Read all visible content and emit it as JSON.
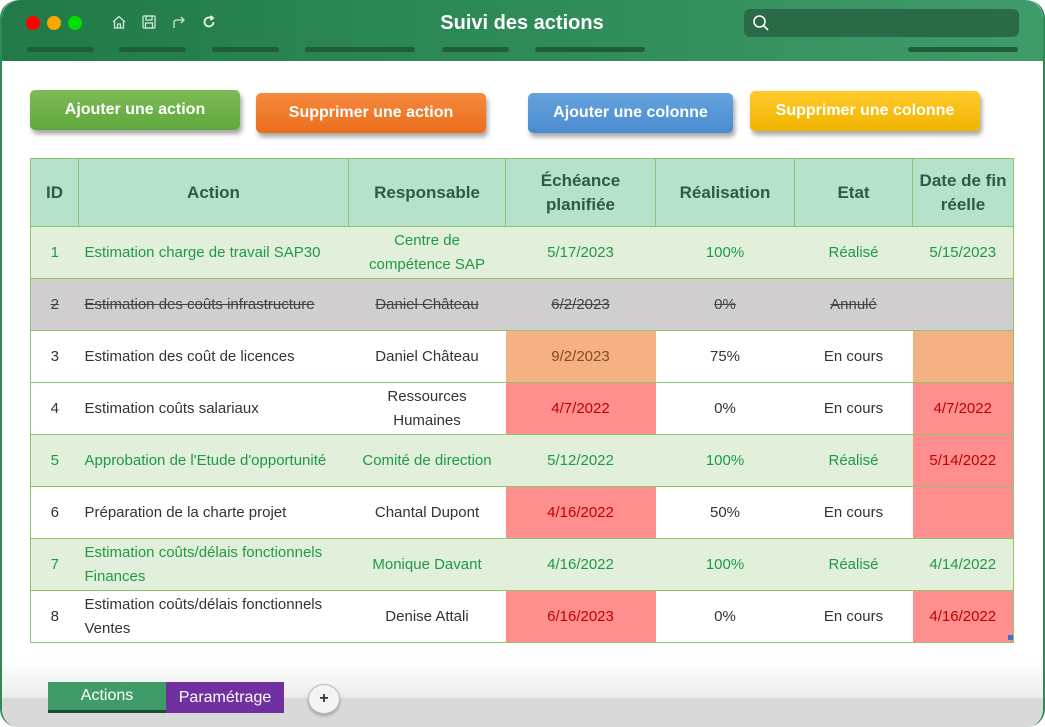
{
  "window": {
    "title": "Suivi des actions",
    "traffic_lights": [
      "close",
      "minimize",
      "maximize"
    ],
    "toolbar_icons": [
      "home-icon",
      "save-icon",
      "redo-icon",
      "refresh-icon"
    ],
    "search": {
      "placeholder": "",
      "value": ""
    }
  },
  "buttons": {
    "add_action": "Ajouter une action",
    "delete_action": "Supprimer une action",
    "add_column": "Ajouter une colonne",
    "delete_column": "Supprimer une colonne"
  },
  "table": {
    "headers": [
      "ID",
      "Action",
      "Responsable",
      "Échéance planifiée",
      "Réalisation",
      "Etat",
      "Date de fin réelle"
    ],
    "rows": [
      {
        "id": "1",
        "action": "Estimation charge de travail SAP30",
        "responsable": "Centre de compétence SAP",
        "echeance": "5/17/2023",
        "realisation": "100%",
        "etat": "Réalisé",
        "fin_reelle": "5/15/2023",
        "status": "done",
        "echeance_flag": "",
        "fin_flag": ""
      },
      {
        "id": "2",
        "action": "Estimation des coûts infrastructure",
        "responsable": "Daniel Château",
        "echeance": "6/2/2023",
        "realisation": "0%",
        "etat": "Annulé",
        "fin_reelle": "",
        "status": "cancel",
        "echeance_flag": "",
        "fin_flag": ""
      },
      {
        "id": "3",
        "action": "Estimation des coût de licences",
        "responsable": "Daniel Château",
        "echeance": "9/2/2023",
        "realisation": "75%",
        "etat": "En cours",
        "fin_reelle": "",
        "status": "normal",
        "echeance_flag": "warn",
        "fin_flag": "warn"
      },
      {
        "id": "4",
        "action": "Estimation coûts salariaux",
        "responsable": "Ressources Humaines",
        "echeance": "4/7/2022",
        "realisation": "0%",
        "etat": "En cours",
        "fin_reelle": "4/7/2022",
        "status": "normal",
        "echeance_flag": "late",
        "fin_flag": "late"
      },
      {
        "id": "5",
        "action": "Approbation de l'Etude d'opportunité",
        "responsable": "Comité de direction",
        "echeance": "5/12/2022",
        "realisation": "100%",
        "etat": "Réalisé",
        "fin_reelle": "5/14/2022",
        "status": "done",
        "echeance_flag": "",
        "fin_flag": "late"
      },
      {
        "id": "6",
        "action": "Préparation de la charte projet",
        "responsable": "Chantal Dupont",
        "echeance": "4/16/2022",
        "realisation": "50%",
        "etat": "En cours",
        "fin_reelle": "",
        "status": "normal",
        "echeance_flag": "late",
        "fin_flag": "late"
      },
      {
        "id": "7",
        "action": "Estimation coûts/délais fonctionnels Finances",
        "responsable": "Monique Davant",
        "echeance": "4/16/2022",
        "realisation": "100%",
        "etat": "Réalisé",
        "fin_reelle": "4/14/2022",
        "status": "done",
        "echeance_flag": "",
        "fin_flag": ""
      },
      {
        "id": "8",
        "action": "Estimation coûts/délais fonctionnels Ventes",
        "responsable": "Denise Attali",
        "echeance": "6/16/2023",
        "realisation": "0%",
        "etat": "En cours",
        "fin_reelle": "4/16/2022",
        "status": "normal",
        "echeance_flag": "late",
        "fin_flag": "late"
      }
    ]
  },
  "sheets": {
    "tabs": [
      "Actions",
      "Paramétrage"
    ],
    "active": "Actions",
    "add_label": "+"
  },
  "colors": {
    "header_bg": "#b7e1cd",
    "done_row_bg": "#e2efda",
    "done_text": "#1e9a46",
    "cancel_row_bg": "#d0cece",
    "late_bg": "#ff8f8f",
    "late_text": "#c00000",
    "warn_bg": "#f4b183",
    "tab_actions": "#3f9c6a",
    "tab_param": "#7030a0"
  }
}
